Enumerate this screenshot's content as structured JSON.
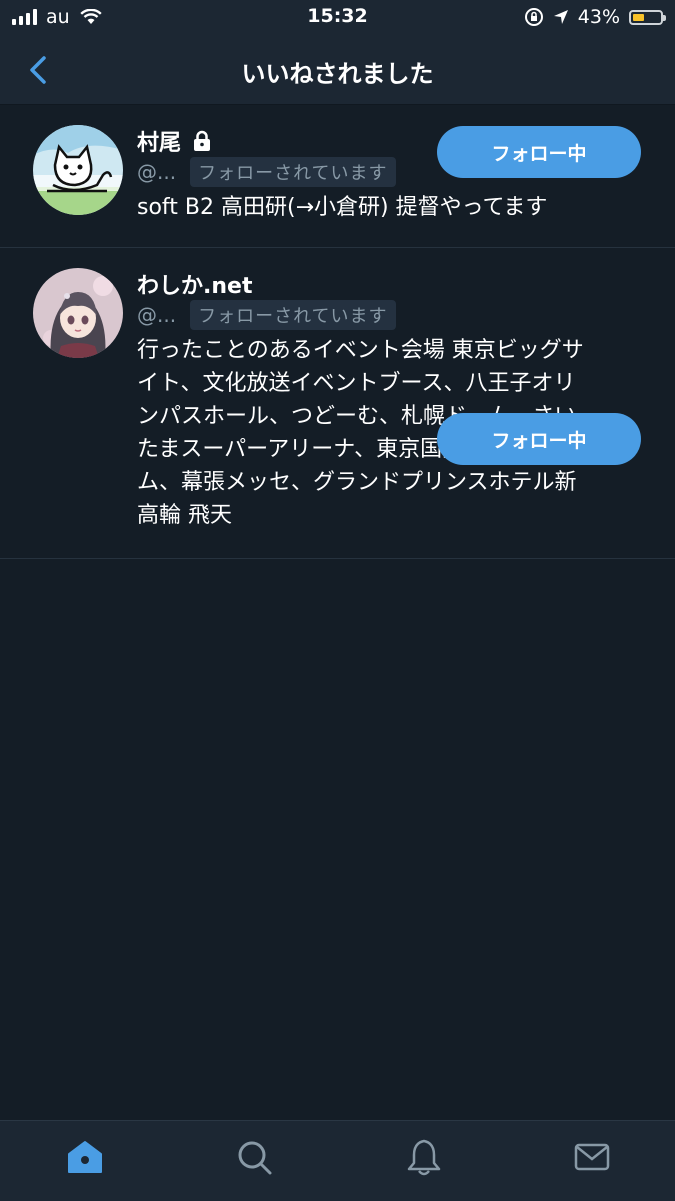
{
  "status_bar": {
    "carrier": "au",
    "time": "15:32",
    "battery": "43%",
    "battery_level": 0.43
  },
  "nav": {
    "title": "いいねされました"
  },
  "users": [
    {
      "name": "村尾",
      "handle": "@...",
      "follows_you": "フォローされています",
      "follow_button": "フォロー中",
      "bio_lines": [
        "soft B2 高田研(→小倉研) 提督やってます"
      ],
      "protected": true
    },
    {
      "name": "わしか.net",
      "handle": "@...",
      "follows_you": "フォローされています",
      "follow_button": "フォロー中",
      "bio_lines": [
        "行ったことのあるイベント会場 東京ビッグサ",
        "イト、文化放送イベントブース、八王子オリ",
        "ンパスホール、つどーむ、札幌ドーム、さい",
        "たまスーパーアリーナ、東京国際フォーラ",
        "ム、幕張メッセ、グランドプリンスホテル新",
        "高輪 飛天"
      ],
      "protected": false
    }
  ],
  "tabbar": {
    "icons": [
      "home-icon",
      "search-icon",
      "bell-icon",
      "mail-icon"
    ]
  },
  "colors": {
    "accent": "#4a9de4",
    "background": "#141d26",
    "bar": "#1c2733"
  }
}
